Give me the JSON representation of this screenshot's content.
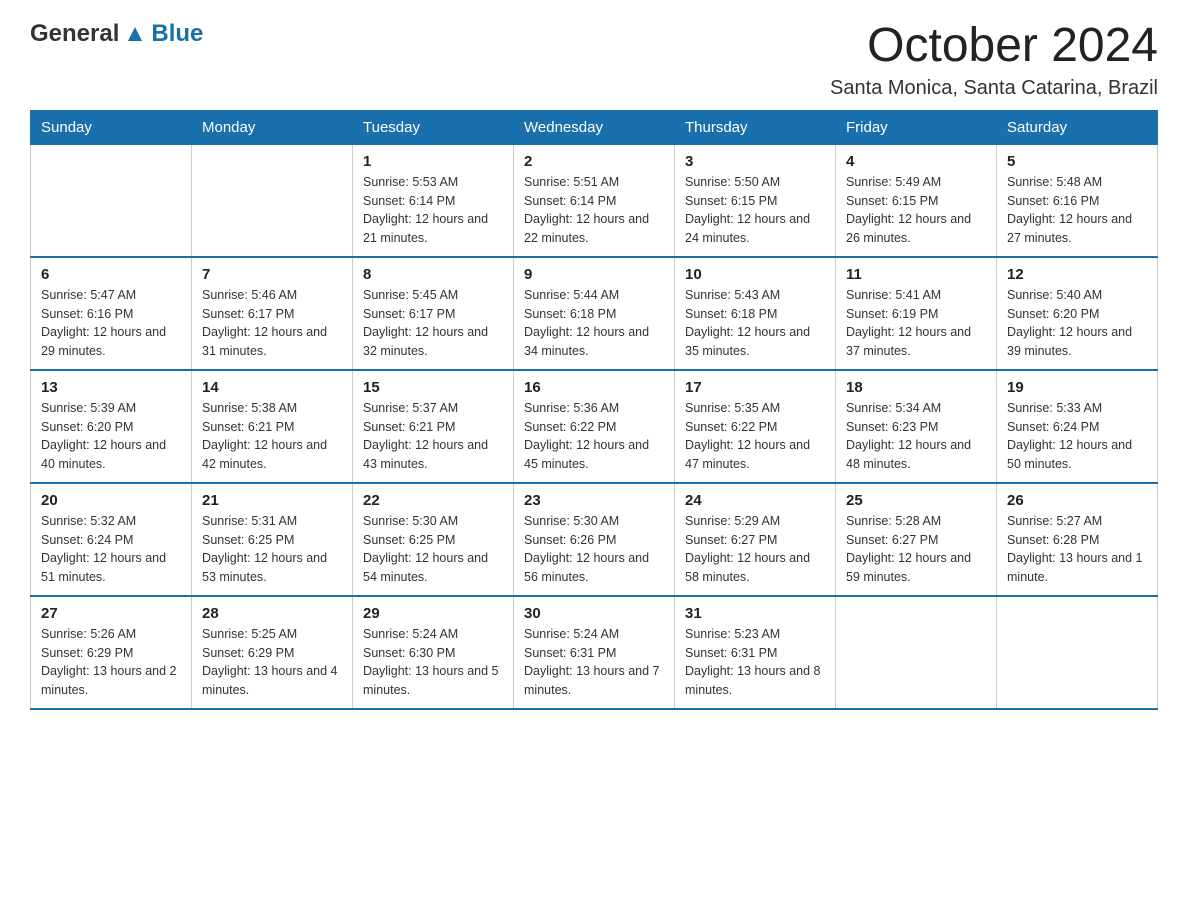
{
  "header": {
    "logo": {
      "general": "General",
      "blue": "Blue"
    },
    "title": "October 2024",
    "location": "Santa Monica, Santa Catarina, Brazil"
  },
  "days_of_week": [
    "Sunday",
    "Monday",
    "Tuesday",
    "Wednesday",
    "Thursday",
    "Friday",
    "Saturday"
  ],
  "weeks": [
    [
      {
        "day": "",
        "info": ""
      },
      {
        "day": "",
        "info": ""
      },
      {
        "day": "1",
        "info": "Sunrise: 5:53 AM\nSunset: 6:14 PM\nDaylight: 12 hours and 21 minutes."
      },
      {
        "day": "2",
        "info": "Sunrise: 5:51 AM\nSunset: 6:14 PM\nDaylight: 12 hours and 22 minutes."
      },
      {
        "day": "3",
        "info": "Sunrise: 5:50 AM\nSunset: 6:15 PM\nDaylight: 12 hours and 24 minutes."
      },
      {
        "day": "4",
        "info": "Sunrise: 5:49 AM\nSunset: 6:15 PM\nDaylight: 12 hours and 26 minutes."
      },
      {
        "day": "5",
        "info": "Sunrise: 5:48 AM\nSunset: 6:16 PM\nDaylight: 12 hours and 27 minutes."
      }
    ],
    [
      {
        "day": "6",
        "info": "Sunrise: 5:47 AM\nSunset: 6:16 PM\nDaylight: 12 hours and 29 minutes."
      },
      {
        "day": "7",
        "info": "Sunrise: 5:46 AM\nSunset: 6:17 PM\nDaylight: 12 hours and 31 minutes."
      },
      {
        "day": "8",
        "info": "Sunrise: 5:45 AM\nSunset: 6:17 PM\nDaylight: 12 hours and 32 minutes."
      },
      {
        "day": "9",
        "info": "Sunrise: 5:44 AM\nSunset: 6:18 PM\nDaylight: 12 hours and 34 minutes."
      },
      {
        "day": "10",
        "info": "Sunrise: 5:43 AM\nSunset: 6:18 PM\nDaylight: 12 hours and 35 minutes."
      },
      {
        "day": "11",
        "info": "Sunrise: 5:41 AM\nSunset: 6:19 PM\nDaylight: 12 hours and 37 minutes."
      },
      {
        "day": "12",
        "info": "Sunrise: 5:40 AM\nSunset: 6:20 PM\nDaylight: 12 hours and 39 minutes."
      }
    ],
    [
      {
        "day": "13",
        "info": "Sunrise: 5:39 AM\nSunset: 6:20 PM\nDaylight: 12 hours and 40 minutes."
      },
      {
        "day": "14",
        "info": "Sunrise: 5:38 AM\nSunset: 6:21 PM\nDaylight: 12 hours and 42 minutes."
      },
      {
        "day": "15",
        "info": "Sunrise: 5:37 AM\nSunset: 6:21 PM\nDaylight: 12 hours and 43 minutes."
      },
      {
        "day": "16",
        "info": "Sunrise: 5:36 AM\nSunset: 6:22 PM\nDaylight: 12 hours and 45 minutes."
      },
      {
        "day": "17",
        "info": "Sunrise: 5:35 AM\nSunset: 6:22 PM\nDaylight: 12 hours and 47 minutes."
      },
      {
        "day": "18",
        "info": "Sunrise: 5:34 AM\nSunset: 6:23 PM\nDaylight: 12 hours and 48 minutes."
      },
      {
        "day": "19",
        "info": "Sunrise: 5:33 AM\nSunset: 6:24 PM\nDaylight: 12 hours and 50 minutes."
      }
    ],
    [
      {
        "day": "20",
        "info": "Sunrise: 5:32 AM\nSunset: 6:24 PM\nDaylight: 12 hours and 51 minutes."
      },
      {
        "day": "21",
        "info": "Sunrise: 5:31 AM\nSunset: 6:25 PM\nDaylight: 12 hours and 53 minutes."
      },
      {
        "day": "22",
        "info": "Sunrise: 5:30 AM\nSunset: 6:25 PM\nDaylight: 12 hours and 54 minutes."
      },
      {
        "day": "23",
        "info": "Sunrise: 5:30 AM\nSunset: 6:26 PM\nDaylight: 12 hours and 56 minutes."
      },
      {
        "day": "24",
        "info": "Sunrise: 5:29 AM\nSunset: 6:27 PM\nDaylight: 12 hours and 58 minutes."
      },
      {
        "day": "25",
        "info": "Sunrise: 5:28 AM\nSunset: 6:27 PM\nDaylight: 12 hours and 59 minutes."
      },
      {
        "day": "26",
        "info": "Sunrise: 5:27 AM\nSunset: 6:28 PM\nDaylight: 13 hours and 1 minute."
      }
    ],
    [
      {
        "day": "27",
        "info": "Sunrise: 5:26 AM\nSunset: 6:29 PM\nDaylight: 13 hours and 2 minutes."
      },
      {
        "day": "28",
        "info": "Sunrise: 5:25 AM\nSunset: 6:29 PM\nDaylight: 13 hours and 4 minutes."
      },
      {
        "day": "29",
        "info": "Sunrise: 5:24 AM\nSunset: 6:30 PM\nDaylight: 13 hours and 5 minutes."
      },
      {
        "day": "30",
        "info": "Sunrise: 5:24 AM\nSunset: 6:31 PM\nDaylight: 13 hours and 7 minutes."
      },
      {
        "day": "31",
        "info": "Sunrise: 5:23 AM\nSunset: 6:31 PM\nDaylight: 13 hours and 8 minutes."
      },
      {
        "day": "",
        "info": ""
      },
      {
        "day": "",
        "info": ""
      }
    ]
  ]
}
